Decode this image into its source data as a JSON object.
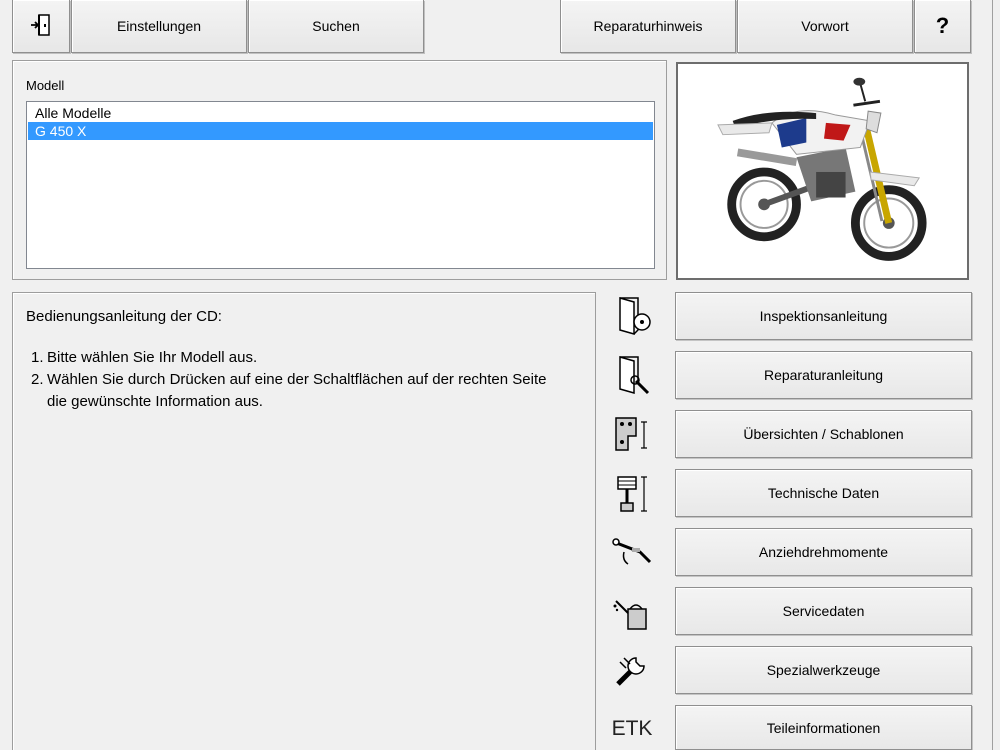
{
  "toolbar": {
    "exit_icon": "exit-door-icon",
    "settings_label": "Einstellungen",
    "search_label": "Suchen",
    "repair_notes_label": "Reparaturhinweis",
    "foreword_label": "Vorwort",
    "help_label": "?"
  },
  "model": {
    "label": "Modell",
    "items": [
      {
        "label": "Alle Modelle",
        "selected": false
      },
      {
        "label": "G 450 X",
        "selected": true
      }
    ]
  },
  "image": {
    "icon": "motorcycle-image"
  },
  "instructions": {
    "title": "Bedienungsanleitung der CD:",
    "steps": [
      {
        "num": "1.",
        "text": "Bitte wählen Sie Ihr Modell aus."
      },
      {
        "num": "2.",
        "text": "Wählen Sie durch Drücken auf eine der Schaltflächen auf der rechten Seite die gewünschte Information aus."
      }
    ]
  },
  "sections": [
    {
      "label": "Inspektionsanleitung",
      "icon": "manual-cd-icon"
    },
    {
      "label": "Reparaturanleitung",
      "icon": "manual-wrench-icon"
    },
    {
      "label": "Übersichten / Schablonen",
      "icon": "template-icon"
    },
    {
      "label": "Technische Daten",
      "icon": "piston-icon"
    },
    {
      "label": "Anziehdrehmomente",
      "icon": "torque-wrench-icon"
    },
    {
      "label": "Servicedaten",
      "icon": "oil-can-icon"
    },
    {
      "label": "Spezialwerkzeuge",
      "icon": "wrench-icon"
    },
    {
      "label": "Teileinformationen",
      "icon": "etk-icon",
      "icon_text": "ETK"
    }
  ]
}
